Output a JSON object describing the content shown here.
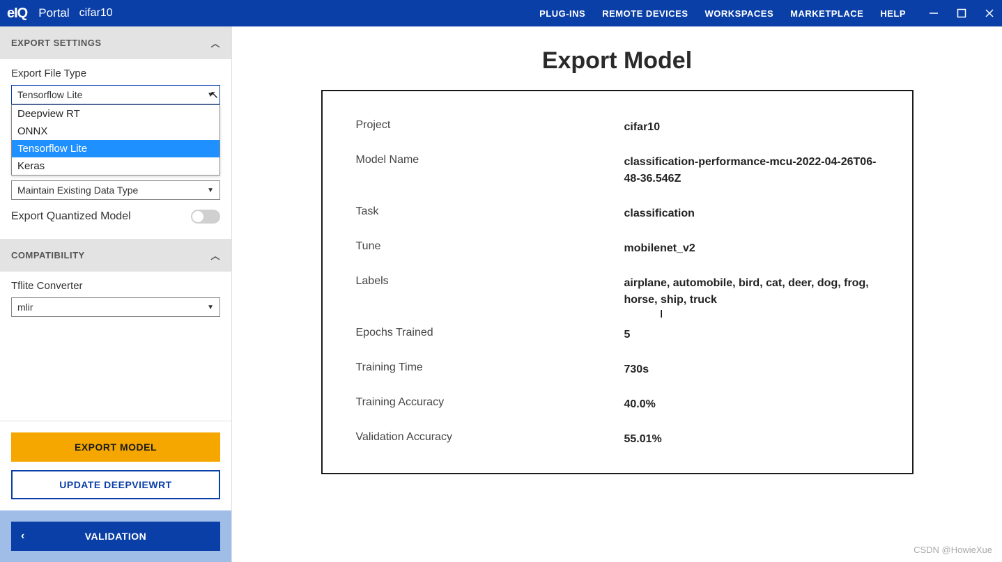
{
  "titlebar": {
    "logo": "eIQ",
    "portal": "Portal",
    "project": "cifar10",
    "nav": [
      "PLUG-INS",
      "REMOTE DEVICES",
      "WORKSPACES",
      "MARKETPLACE",
      "HELP"
    ]
  },
  "sidebar": {
    "export_settings_header": "EXPORT SETTINGS",
    "compatibility_header": "COMPATIBILITY",
    "export_file_type": {
      "label": "Export File Type",
      "selected": "Tensorflow Lite",
      "options": [
        "Deepview RT",
        "ONNX",
        "Tensorflow Lite",
        "Keras"
      ]
    },
    "export_data_type": {
      "selected": "Maintain Existing Data Type"
    },
    "quantized_toggle": {
      "label": "Export Quantized Model",
      "value": false
    },
    "tflite_converter": {
      "label": "Tflite Converter",
      "selected": "mlir"
    },
    "buttons": {
      "export": "EXPORT MODEL",
      "update": "UPDATE DEEPVIEWRT",
      "validation": "VALIDATION"
    }
  },
  "content": {
    "title": "Export Model",
    "rows": [
      {
        "label": "Project",
        "value": "cifar10"
      },
      {
        "label": "Model Name",
        "value": "classification-performance-mcu-2022-04-26T06-48-36.546Z"
      },
      {
        "label": "Task",
        "value": "classification"
      },
      {
        "label": "Tune",
        "value": "mobilenet_v2"
      },
      {
        "label": "Labels",
        "value": "airplane, automobile, bird, cat, deer, dog, frog, horse, ship, truck"
      },
      {
        "label": "Epochs Trained",
        "value": "5"
      },
      {
        "label": "Training Time",
        "value": "730s"
      },
      {
        "label": "Training Accuracy",
        "value": "40.0%"
      },
      {
        "label": "Validation Accuracy",
        "value": "55.01%"
      }
    ]
  },
  "watermark": "CSDN @HowieXue"
}
